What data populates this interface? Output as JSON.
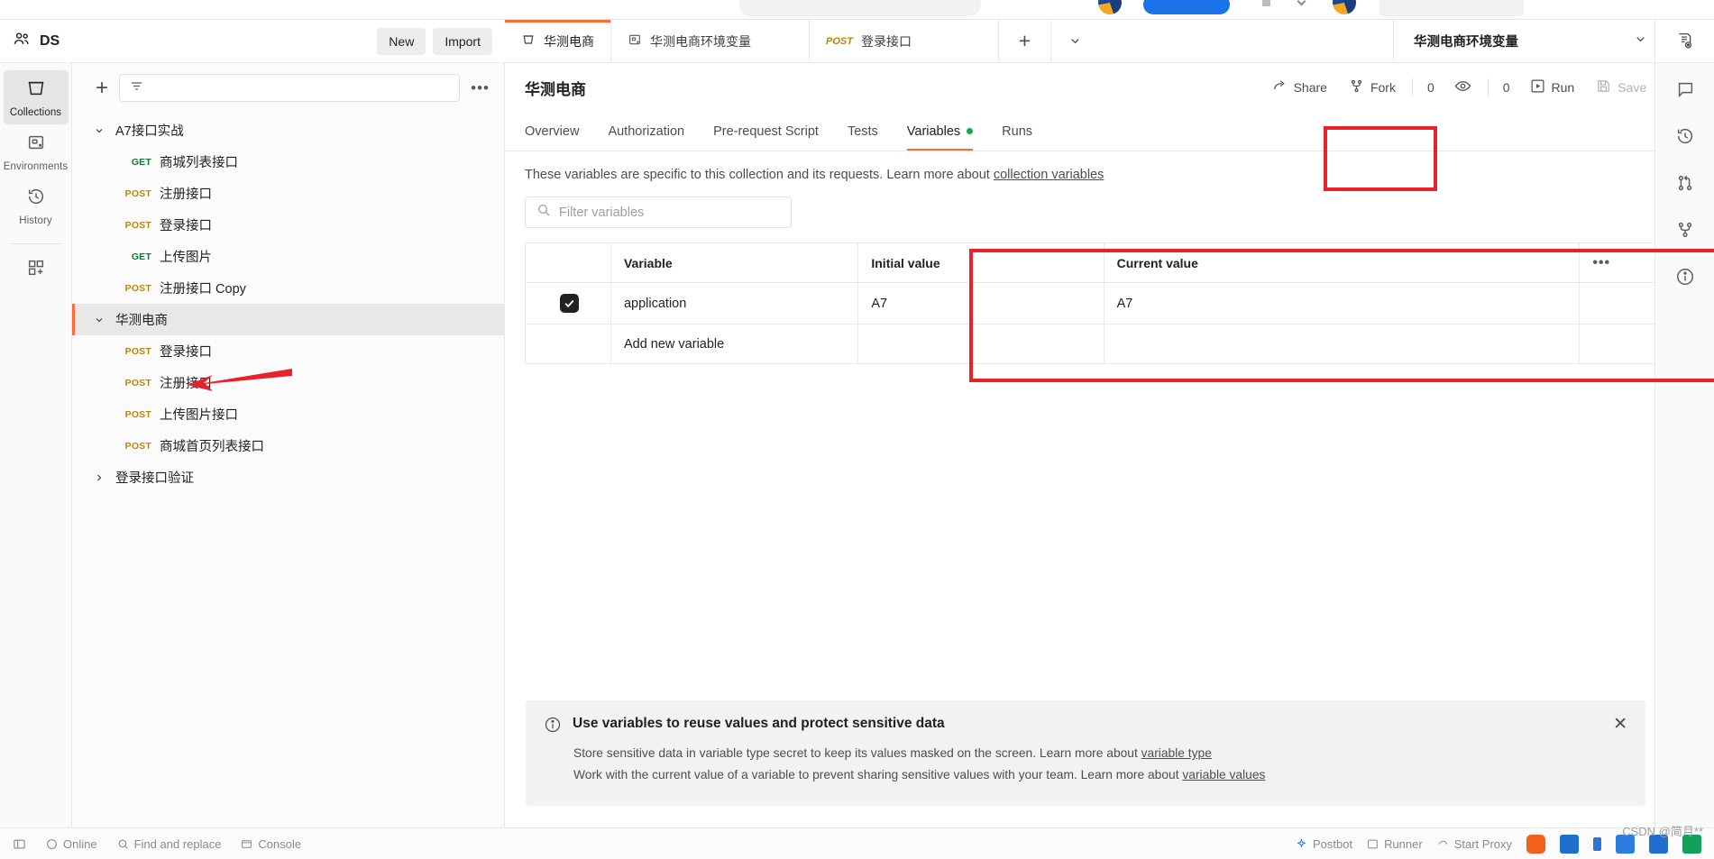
{
  "workspace": {
    "name": "DS",
    "new_label": "New",
    "import_label": "Import"
  },
  "rail": {
    "items": [
      {
        "label": "Collections",
        "icon": "collections-icon",
        "active": true
      },
      {
        "label": "Environments",
        "icon": "environments-icon",
        "active": false
      },
      {
        "label": "History",
        "icon": "history-icon",
        "active": false
      }
    ],
    "add_label": "",
    "add_icon": "new-module-icon"
  },
  "sidebar": {
    "filter_placeholder": "",
    "more_label": "•••",
    "tree": [
      {
        "type": "collection",
        "name": "A7接口实战",
        "expanded": true,
        "selected": false
      },
      {
        "type": "request",
        "method": "GET",
        "name": "商城列表接口"
      },
      {
        "type": "request",
        "method": "POST",
        "name": "注册接口"
      },
      {
        "type": "request",
        "method": "POST",
        "name": "登录接口"
      },
      {
        "type": "request",
        "method": "GET",
        "name": "上传图片"
      },
      {
        "type": "request",
        "method": "POST",
        "name": "注册接口 Copy"
      },
      {
        "type": "collection",
        "name": "华测电商",
        "expanded": true,
        "selected": true
      },
      {
        "type": "request",
        "method": "POST",
        "name": "登录接口"
      },
      {
        "type": "request",
        "method": "POST",
        "name": "注册接口"
      },
      {
        "type": "request",
        "method": "POST",
        "name": "上传图片接口"
      },
      {
        "type": "request",
        "method": "POST",
        "name": "商城首页列表接口"
      },
      {
        "type": "collection",
        "name": "登录接口验证",
        "expanded": false,
        "selected": false
      }
    ]
  },
  "tabbar": {
    "tabs": [
      {
        "label": "华测电商",
        "icon": "collection-icon",
        "method": "",
        "active": true
      },
      {
        "label": "华测电商环境变量",
        "icon": "environment-icon",
        "method": "",
        "active": false
      },
      {
        "label": "登录接口",
        "icon": "",
        "method": "POST",
        "active": false
      }
    ],
    "new_tab_label": "+",
    "environment": "华测电商环境变量"
  },
  "collection": {
    "title": "华测电商",
    "actions": {
      "share": "Share",
      "fork": "Fork",
      "fork_count": "0",
      "watch_count": "0",
      "run": "Run",
      "save": "Save",
      "more": "•••"
    },
    "tabs": [
      {
        "label": "Overview",
        "active": false,
        "dot": false
      },
      {
        "label": "Authorization",
        "active": false,
        "dot": false
      },
      {
        "label": "Pre-request Script",
        "active": false,
        "dot": false
      },
      {
        "label": "Tests",
        "active": false,
        "dot": false
      },
      {
        "label": "Variables",
        "active": true,
        "dot": true
      },
      {
        "label": "Runs",
        "active": false,
        "dot": false
      }
    ],
    "description": "These variables are specific to this collection and its requests. Learn more about ",
    "description_link": "collection variables"
  },
  "variables": {
    "filter_placeholder": "Filter variables",
    "columns": [
      "Variable",
      "Initial value",
      "Current value"
    ],
    "more_label": "•••",
    "rows": [
      {
        "checked": true,
        "variable": "application",
        "initial_value": "A7",
        "current_value": "A7"
      }
    ],
    "add_new_placeholder": "Add new variable"
  },
  "banner": {
    "title": "Use variables to reuse values and protect sensitive data",
    "line1_text": "Store sensitive data in variable type secret to keep its values masked on the screen. Learn more about ",
    "line1_link": "variable type",
    "line2_text": "Work with the current value of a variable to prevent sharing sensitive values with your team. Learn more about ",
    "line2_link": "variable values",
    "close_label": "✕"
  },
  "statusbar": {
    "left_items": [
      "Online",
      "Find and replace",
      "Console"
    ],
    "right_items": [
      "Postbot",
      "Runner",
      "Start Proxy"
    ]
  },
  "watermark": "CSDN @简月**",
  "colors": {
    "accent": "#ff6c37",
    "annotation": "#e8212a",
    "get": "#0a7d33",
    "post": "#b8860b",
    "active_dot": "#17a74a"
  }
}
